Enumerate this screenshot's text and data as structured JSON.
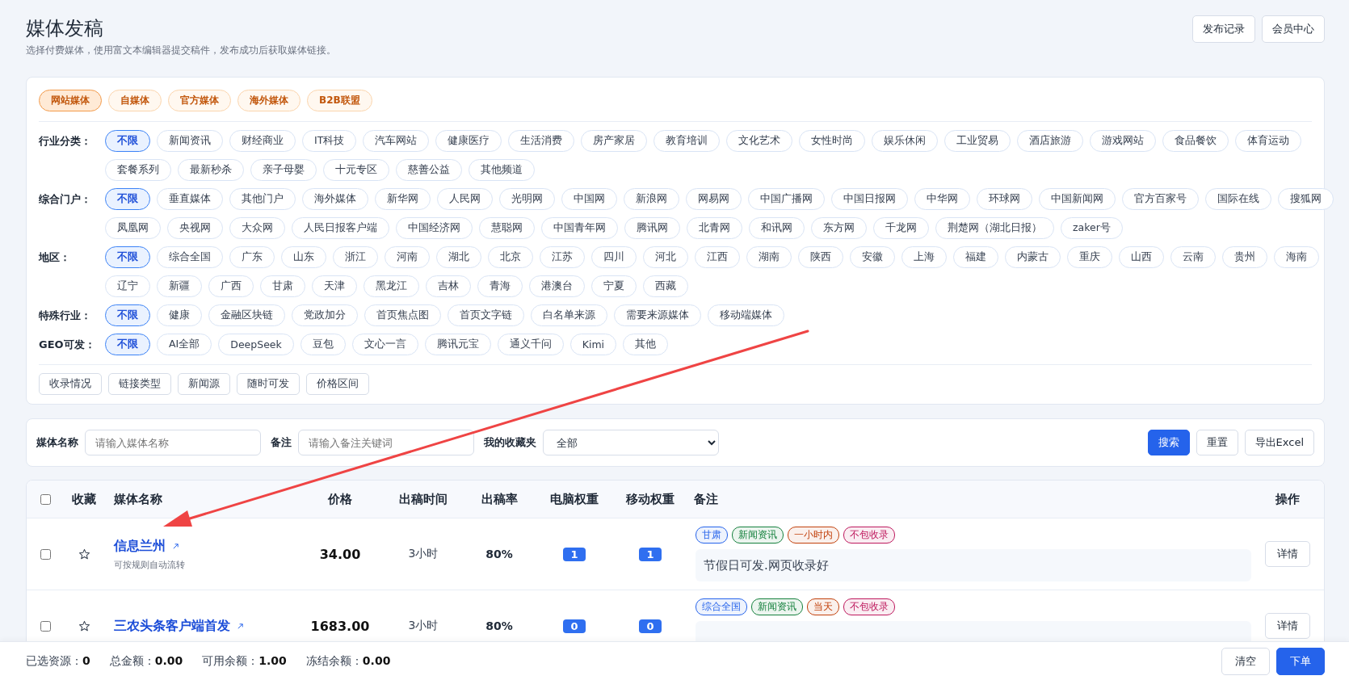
{
  "header": {
    "title": "媒体发稿",
    "subtitle": "选择付费媒体，使用富文本编辑器提交稿件，发布成功后获取媒体链接。",
    "buttons": [
      "发布记录",
      "会员中心"
    ]
  },
  "media_types": [
    {
      "label": "网站媒体",
      "selected": true
    },
    {
      "label": "自媒体",
      "selected": false
    },
    {
      "label": "官方媒体",
      "selected": false
    },
    {
      "label": "海外媒体",
      "selected": false
    },
    {
      "label": "B2B联盟",
      "selected": false
    }
  ],
  "filter_groups": [
    {
      "label": "行业分类：",
      "lines": [
        [
          {
            "label": "不限",
            "selected": true
          },
          "新闻资讯",
          "财经商业",
          "IT科技",
          "汽车网站",
          "健康医疗",
          "生活消费",
          "房产家居",
          "教育培训",
          "文化艺术",
          "女性时尚",
          "娱乐休闲",
          "工业贸易",
          "酒店旅游",
          "游戏网站",
          "食品餐饮",
          "体育运动"
        ],
        [
          "套餐系列",
          "最新秒杀",
          "亲子母婴",
          "十元专区",
          "慈善公益",
          "其他频道"
        ]
      ]
    },
    {
      "label": "综合门户：",
      "lines": [
        [
          {
            "label": "不限",
            "selected": true
          },
          "垂直媒体",
          "其他门户",
          "海外媒体",
          "新华网",
          "人民网",
          "光明网",
          "中国网",
          "新浪网",
          "网易网",
          "中国广播网",
          "中国日报网",
          "中华网",
          "环球网",
          "中国新闻网",
          "官方百家号",
          "国际在线",
          "搜狐网"
        ],
        [
          "凤凰网",
          "央视网",
          "大众网",
          "人民日报客户端",
          "中国经济网",
          "慧聪网",
          "中国青年网",
          "腾讯网",
          "北青网",
          "和讯网",
          "东方网",
          "千龙网",
          "荆楚网（湖北日报）",
          "zaker号"
        ]
      ]
    },
    {
      "label": "地区：",
      "lines": [
        [
          {
            "label": "不限",
            "selected": true
          },
          "综合全国",
          "广东",
          "山东",
          "浙江",
          "河南",
          "湖北",
          "北京",
          "江苏",
          "四川",
          "河北",
          "江西",
          "湖南",
          "陕西",
          "安徽",
          "上海",
          "福建",
          "内蒙古",
          "重庆",
          "山西",
          "云南",
          "贵州",
          "海南"
        ],
        [
          "辽宁",
          "新疆",
          "广西",
          "甘肃",
          "天津",
          "黑龙江",
          "吉林",
          "青海",
          "港澳台",
          "宁夏",
          "西藏"
        ]
      ]
    },
    {
      "label": "特殊行业：",
      "lines": [
        [
          {
            "label": "不限",
            "selected": true
          },
          "健康",
          "金融区块链",
          "党政加分",
          "首页焦点图",
          "首页文字链",
          "白名单来源",
          "需要来源媒体",
          "移动端媒体"
        ]
      ]
    },
    {
      "label": "GEO可发：",
      "lines": [
        [
          {
            "label": "不限",
            "selected": true
          },
          "AI全部",
          "DeepSeek",
          "豆包",
          "文心一言",
          "腾讯元宝",
          "通义千问",
          "Kimi",
          "其他"
        ]
      ]
    }
  ],
  "extra_filters": [
    "收录情况",
    "链接类型",
    "新闻源",
    "随时可发",
    "价格区间"
  ],
  "search_bar": {
    "fields": [
      {
        "kind": "input",
        "label": "媒体名称",
        "placeholder": "请输入媒体名称"
      },
      {
        "kind": "input",
        "label": "备注",
        "placeholder": "请输入备注关键词"
      },
      {
        "kind": "select",
        "label": "我的收藏夹",
        "value": "全部"
      }
    ],
    "buttons": [
      {
        "label": "搜索",
        "primary": true
      },
      {
        "label": "重置",
        "primary": false
      },
      {
        "label": "导出Excel",
        "primary": false
      }
    ]
  },
  "table": {
    "select_all_checked": false,
    "columns": [
      "收藏",
      "媒体名称",
      "价格",
      "出稿时间",
      "出稿率",
      "电脑权重",
      "移动权重",
      "备注",
      "操作"
    ],
    "rows": [
      {
        "checked": false,
        "favorite": false,
        "name": "信息兰州",
        "subtitle": "可按规则自动流转",
        "price": "34.00",
        "time": "3小时",
        "rate": "80%",
        "pc_weight": "1",
        "mobile_weight": "1",
        "tags": [
          {
            "label": "甘肃",
            "color": "#2563eb"
          },
          {
            "label": "新闻资讯",
            "color": "#15803d"
          },
          {
            "label": "一小时内",
            "color": "#c2410c"
          },
          {
            "label": "不包收录",
            "color": "#be185d"
          }
        ],
        "note": "节假日可发.网页收录好",
        "action": "详情"
      },
      {
        "checked": false,
        "favorite": false,
        "name": "三农头条客户端首发",
        "price": "1683.00",
        "time": "3小时",
        "rate": "80%",
        "pc_weight": "0",
        "mobile_weight": "0",
        "tags": [
          {
            "label": "综合全国",
            "color": "#2563eb"
          },
          {
            "label": "新闻资讯",
            "color": "#15803d"
          },
          {
            "label": "当天",
            "color": "#c2410c"
          },
          {
            "label": "不包收录",
            "color": "#be185d"
          }
        ],
        "action": "详情"
      }
    ]
  },
  "footer": {
    "summary": [
      "已选资源：**0**",
      "总金额：**0.00**",
      "可用余额：**1.00**",
      "冻结余额：**0.00**"
    ],
    "buttons": [
      {
        "label": "清空",
        "primary": false
      },
      {
        "label": "下单",
        "primary": true
      }
    ]
  },
  "annotation": {
    "kind": "arrow"
  }
}
